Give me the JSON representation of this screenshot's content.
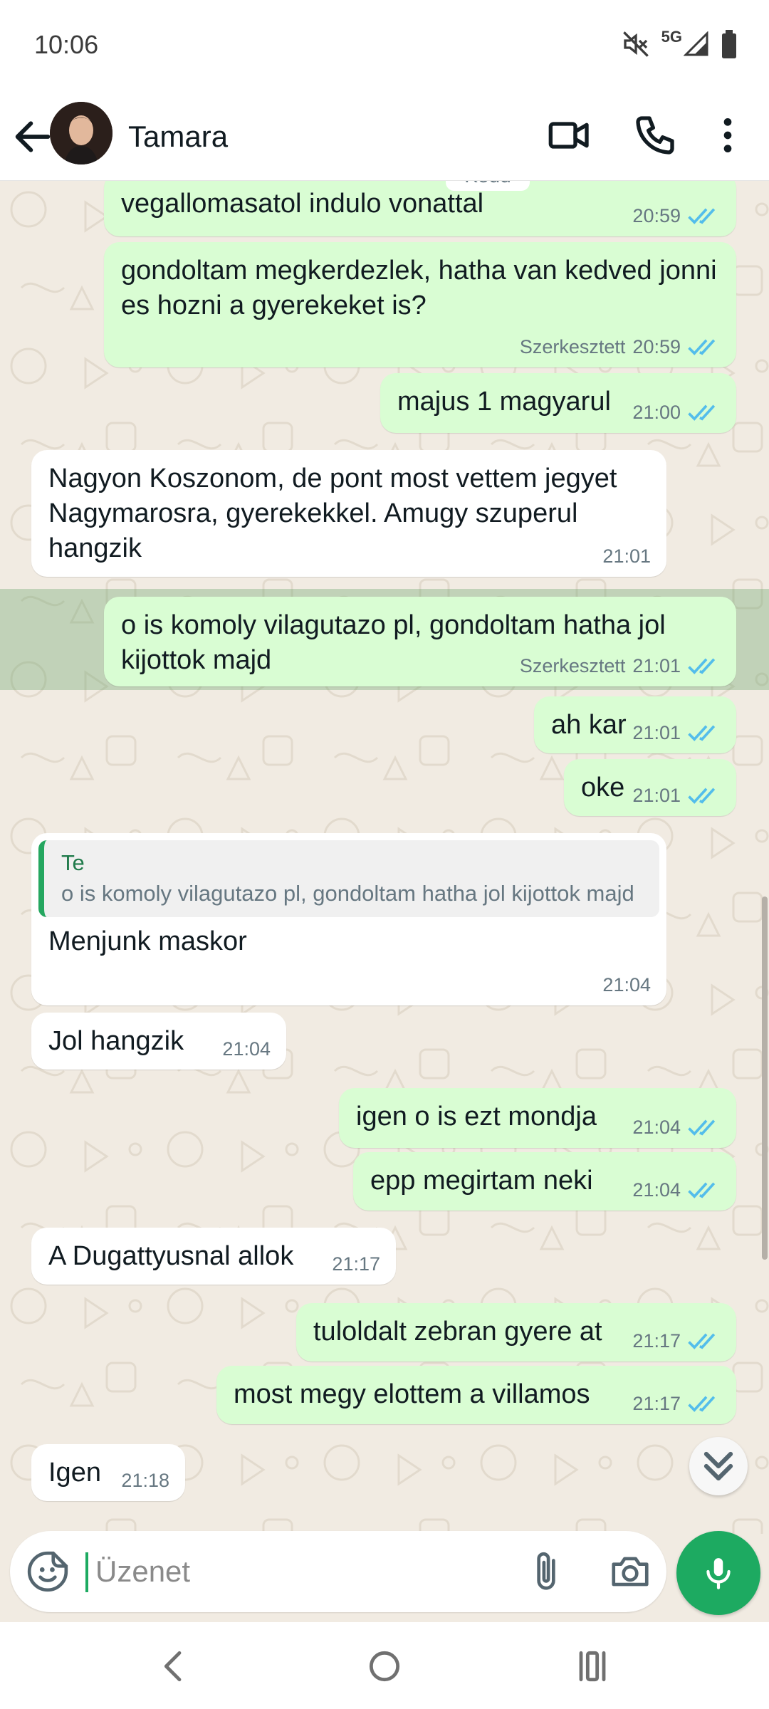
{
  "status_bar": {
    "time": "10:06",
    "network": "5G",
    "icons": [
      "mute-icon",
      "signal-icon",
      "battery-icon"
    ]
  },
  "header": {
    "contact_name": "Tamara",
    "icons": [
      "back-arrow-icon",
      "video-call-icon",
      "phone-icon",
      "more-vertical-icon"
    ]
  },
  "date_chip": "Kedd",
  "messages": [
    {
      "id": 0,
      "direction": "out",
      "text": "vegallomasatol indulo vonattal",
      "time": "20:59",
      "edited": "",
      "ticks": "read"
    },
    {
      "id": 1,
      "direction": "out",
      "text": "gondoltam megkerdezlek, hatha van kedved jonni es hozni a gyerekeket is?",
      "time": "20:59",
      "edited": "Szerkesztett",
      "ticks": "read"
    },
    {
      "id": 2,
      "direction": "out",
      "text": "majus 1 magyarul",
      "time": "21:00",
      "edited": "",
      "ticks": "read"
    },
    {
      "id": 3,
      "direction": "in",
      "text": "Nagyon Koszonom, de pont most vettem jegyet Nagymarosra, gyerekekkel. Amugy szuperul hangzik",
      "time": "21:01"
    },
    {
      "id": 4,
      "direction": "out",
      "text": "o is komoly vilagutazo pl, gondoltam hatha jol kijottok majd",
      "time": "21:01",
      "edited": "Szerkesztett",
      "ticks": "read",
      "highlighted": true
    },
    {
      "id": 5,
      "direction": "out",
      "text": "ah kar",
      "time": "21:01",
      "edited": "",
      "ticks": "read"
    },
    {
      "id": 6,
      "direction": "out",
      "text": "oke",
      "time": "21:01",
      "edited": "",
      "ticks": "read"
    },
    {
      "id": 7,
      "direction": "in",
      "text": "Menjunk maskor",
      "time": "21:04",
      "quote": {
        "author": "Te",
        "text": "o is komoly vilagutazo pl, gondoltam hatha jol kijottok majd"
      }
    },
    {
      "id": 8,
      "direction": "in",
      "text": "Jol hangzik",
      "time": "21:04"
    },
    {
      "id": 9,
      "direction": "out",
      "text": "igen o is ezt mondja",
      "time": "21:04",
      "edited": "",
      "ticks": "read"
    },
    {
      "id": 10,
      "direction": "out",
      "text": "epp megirtam neki",
      "time": "21:04",
      "edited": "",
      "ticks": "read"
    },
    {
      "id": 11,
      "direction": "in",
      "text": "A Dugattyusnal allok",
      "time": "21:17"
    },
    {
      "id": 12,
      "direction": "out",
      "text": "tuloldalt zebran gyere at",
      "time": "21:17",
      "edited": "",
      "ticks": "read"
    },
    {
      "id": 13,
      "direction": "out",
      "text": "most megy elottem a villamos",
      "time": "21:17",
      "edited": "",
      "ticks": "read"
    },
    {
      "id": 14,
      "direction": "in",
      "text": "Igen",
      "time": "21:18"
    }
  ],
  "composer": {
    "placeholder": "Üzenet",
    "icons": [
      "emoji-sticker-icon",
      "paperclip-icon",
      "camera-icon",
      "microphone-icon"
    ]
  },
  "colors": {
    "outgoing_bubble": "#d9fdd3",
    "incoming_bubble": "#ffffff",
    "chat_background": "#f1ebe2",
    "accent": "#1daa61",
    "read_ticks": "#53bdeb"
  },
  "nav": {
    "icons": [
      "nav-back-icon",
      "nav-home-icon",
      "nav-recent-icon"
    ]
  }
}
